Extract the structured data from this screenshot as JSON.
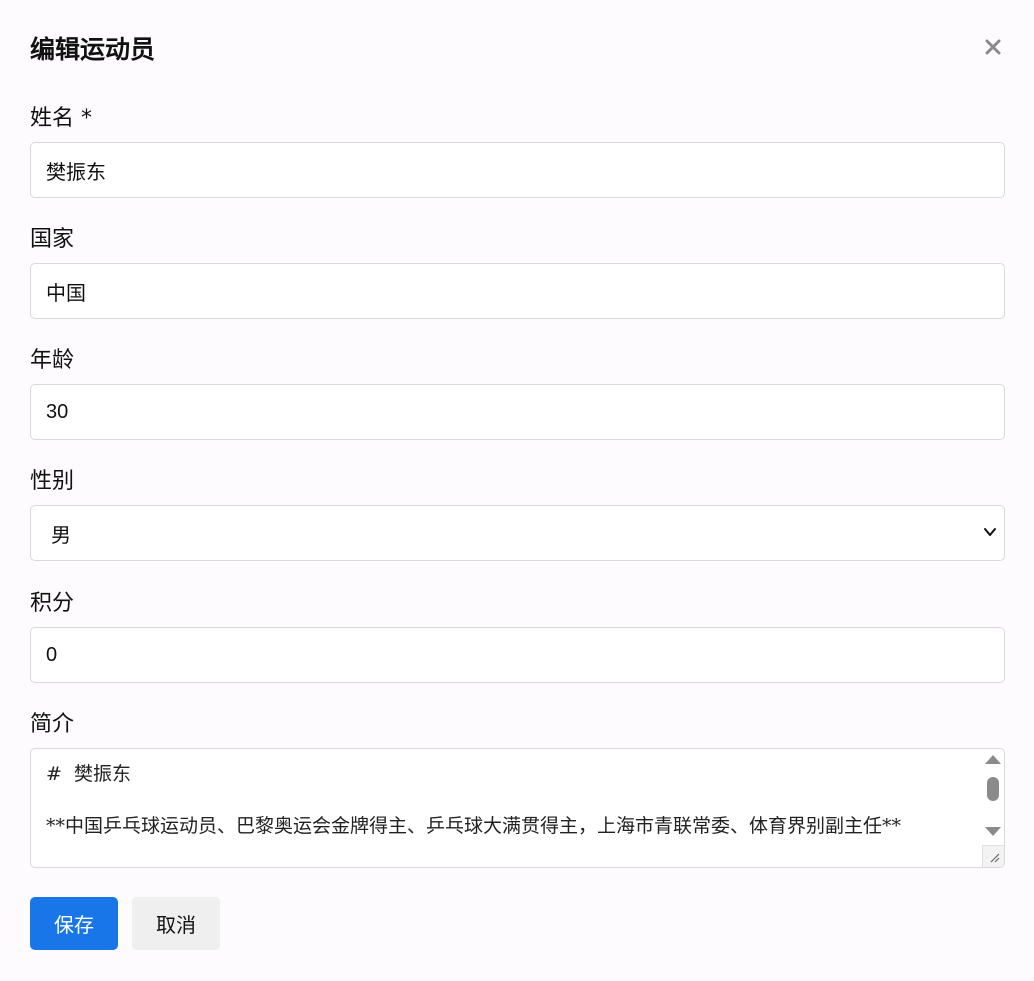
{
  "dialog": {
    "title": "编辑运动员",
    "close_icon": "close-icon"
  },
  "fields": {
    "name": {
      "label": "姓名 *",
      "value": "樊振东"
    },
    "country": {
      "label": "国家",
      "value": "中国"
    },
    "age": {
      "label": "年龄",
      "value": "30"
    },
    "gender": {
      "label": "性别",
      "value": "男"
    },
    "points": {
      "label": "积分",
      "value": "0"
    },
    "bio": {
      "label": "简介",
      "value": "#  樊振东\n\n**中国乒乓球运动员、巴黎奥运会金牌得主、乒乓球大满贯得主，上海市青联常委、体育界别副主任**"
    }
  },
  "actions": {
    "save_label": "保存",
    "cancel_label": "取消"
  },
  "colors": {
    "primary": "#1976e8",
    "secondary": "#efefef",
    "border": "#d9d9dc"
  }
}
